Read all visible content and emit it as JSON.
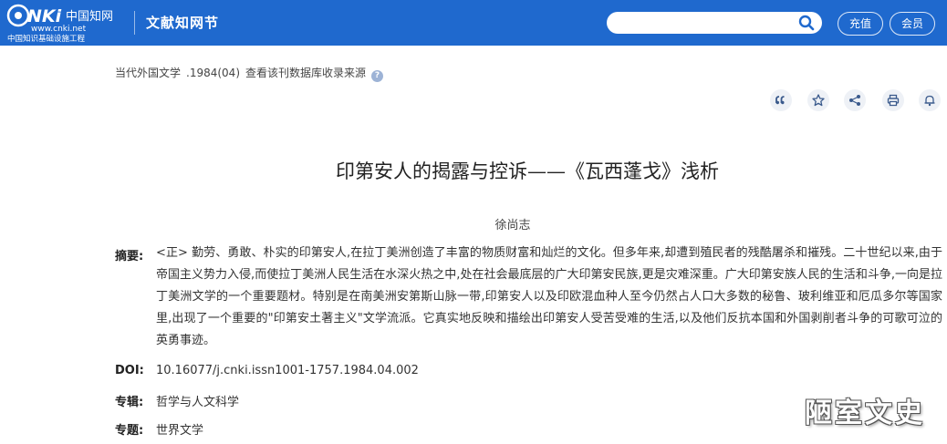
{
  "header": {
    "logo_text": "CNKi中国知网 www.cnki.net 中国知识基础设施工程",
    "section_title": "文献知网节",
    "search": {
      "placeholder": "",
      "value": ""
    },
    "recharge_label": "充值",
    "member_label": "会员"
  },
  "source": {
    "journal": "当代外国文学",
    "issue": ".1984(04)",
    "db_link": "查看该刊数据库收录来源",
    "help": "?"
  },
  "tools": [
    "quote-icon",
    "star-icon",
    "share-icon",
    "print-icon",
    "bell-icon"
  ],
  "article": {
    "title": "印第安人的揭露与控诉——《瓦西蓬戈》浅析",
    "author": "徐尚志",
    "abstract_label": "摘要:",
    "abstract": "<正> 勤劳、勇敢、朴实的印第安人,在拉丁美洲创造了丰富的物质财富和灿烂的文化。但多年来,却遭到殖民者的残酷屠杀和摧残。二十世纪以来,由于帝国主义势力入侵,而使拉丁美洲人民生活在水深火热之中,处在社会最底层的广大印第安民族,更是灾难深重。广大印第安族人民的生活和斗争,一向是拉丁美洲文学的一个重要题材。特别是在南美洲安第斯山脉一带,印第安人以及印欧混血种人至今仍然占人口大多数的秘鲁、玻利维亚和厄瓜多尔等国家里,出现了一个重要的\"印第安土著主义\"文学流派。它真实地反映和描绘出印第安人受苦受难的生活,以及他们反抗本国和外国剥削者斗争的可歌可泣的英勇事迹。",
    "doi_label": "DOI:",
    "doi": "10.16077/j.cnki.issn1001-1757.1984.04.002",
    "series_label": "专辑:",
    "series": "哲学与人文科学",
    "topic_label": "专题:",
    "topic": "世界文学"
  },
  "watermark": "陋室文史"
}
